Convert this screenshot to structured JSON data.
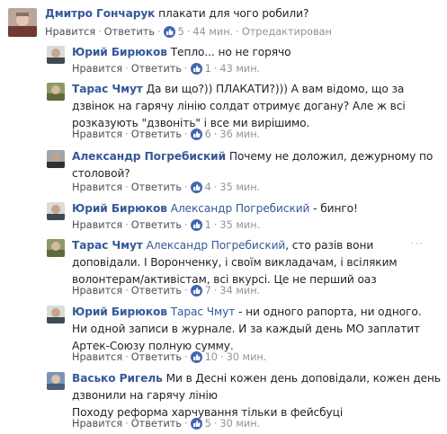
{
  "comments": [
    {
      "author": "Дмитро Гончарук",
      "segments": [
        "плакати для чого робили?"
      ],
      "like": "Нравится",
      "reply": "Ответить",
      "likes": "5",
      "time": "44 мин.",
      "edited": "Отредактирован"
    },
    {
      "author": "Юрий Бирюков",
      "segments": [
        "Тепло... но не горячо"
      ],
      "like": "Нравится",
      "reply": "Ответить",
      "likes": "1",
      "time": "43 мин."
    },
    {
      "author": "Тарас Чмут",
      "segments": [
        "Да ви що?)) ПЛАКАТИ?))) А вам відомо, що за",
        "дзвінок на гарячу лінію солдат отримує догану? Але ж всі",
        "розказують \"дзвоніть\" і все ми вирішимо."
      ],
      "like": "Нравится",
      "reply": "Ответить",
      "likes": "6",
      "time": "36 мин."
    },
    {
      "author": "Александр Погребиский",
      "segments": [
        "Почему не доложил, дежурному по",
        "столовой?"
      ],
      "like": "Нравится",
      "reply": "Ответить",
      "likes": "4",
      "time": "35 мин."
    },
    {
      "author": "Юрий Бирюков",
      "mention": "Александр Погребиский",
      "segments": [
        "- бинго!"
      ],
      "like": "Нравится",
      "reply": "Ответить",
      "likes": "1",
      "time": "35 мин."
    },
    {
      "author": "Тарас Чмут",
      "mention": "Александр Погребиский",
      "segments": [
        ", сто разів вони",
        "доповідали. І Воронченку, і своїм викладачам, і всіляким",
        "волонтерам/активістам, всі вкурсі. Це не перший оаз"
      ],
      "like": "Нравится",
      "reply": "Ответить",
      "likes": "7",
      "time": "34 мин.",
      "menu": "···"
    },
    {
      "author": "Юрий Бирюков",
      "mention": "Тарас Чмут",
      "segments": [
        "- ни одного рапорта, ни одного.",
        "Ни одной записи в журнале. И за каждый день МО заплатит",
        "Артек-Союзу полную сумму."
      ],
      "like": "Нравится",
      "reply": "Ответить",
      "likes": "10",
      "time": "30 мин."
    },
    {
      "author": "Васько Ригель",
      "segments": [
        "Ми в Десні кожен день доповідали, кожен день",
        "дзвонили на гарячу лінію",
        "Походу реформа харчування тільки в фейсбуці"
      ],
      "like": "Нравится",
      "reply": "Ответить",
      "likes": "5",
      "time": "30 мин."
    }
  ]
}
